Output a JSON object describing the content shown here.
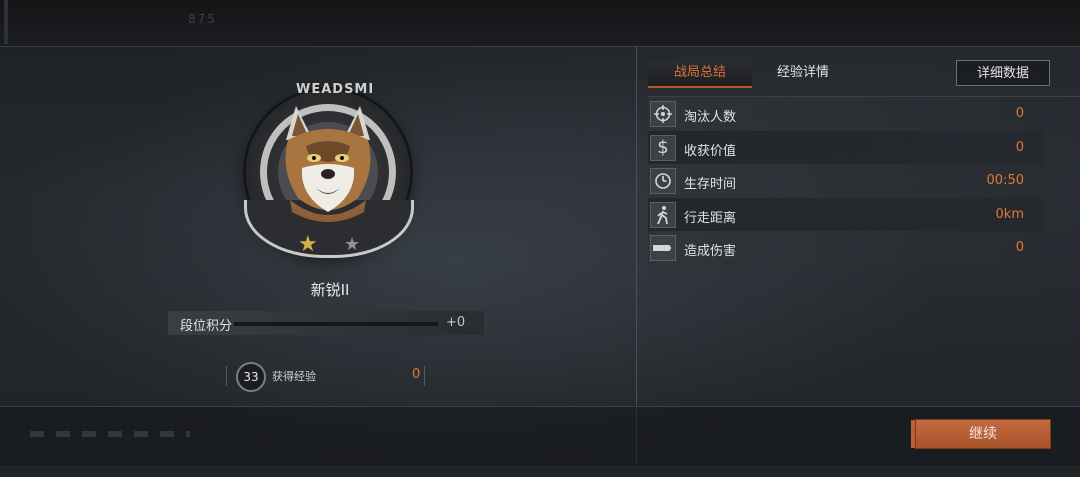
{
  "header": {
    "ghost_text": "875"
  },
  "player": {
    "rank_name": "新锐II",
    "rank_points_label": "段位积分",
    "rank_points_delta": "+0",
    "rank_progress": 0.0,
    "emblem_text": "WEADSMI",
    "emblem_stars": [
      "gold-star-icon",
      "gray-star-icon"
    ]
  },
  "experience": {
    "level": "33",
    "label": "获得经验",
    "value": "0"
  },
  "tabs": [
    {
      "label": "战局总结",
      "active": true
    },
    {
      "label": "经验详情",
      "active": false
    }
  ],
  "detail_button": "详细数据",
  "stats": [
    {
      "icon": "crosshair-icon",
      "label": "淘汰人数",
      "value": "0"
    },
    {
      "icon": "dollar-icon",
      "label": "收获价值",
      "value": "0"
    },
    {
      "icon": "clock-icon",
      "label": "生存时间",
      "value": "00:50"
    },
    {
      "icon": "walking-icon",
      "label": "行走距离",
      "value": "0km"
    },
    {
      "icon": "bullet-icon",
      "label": "造成伤害",
      "value": "0"
    }
  ],
  "continue_button": "继续",
  "colors": {
    "accent": "#e07838",
    "button": "#b85f34",
    "panel": "#2a2d31"
  }
}
